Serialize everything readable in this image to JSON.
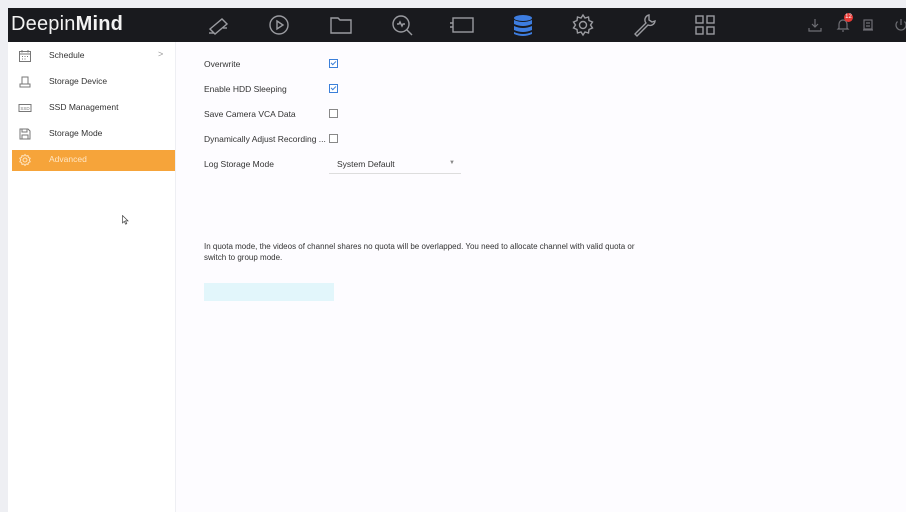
{
  "app": {
    "logo_light": "Deepin",
    "logo_bold": "Mind"
  },
  "topnav": [
    {
      "name": "camera-icon"
    },
    {
      "name": "playback-icon"
    },
    {
      "name": "folder-icon"
    },
    {
      "name": "search-icon"
    },
    {
      "name": "display-icon"
    },
    {
      "name": "storage-icon",
      "active": true
    },
    {
      "name": "gear-icon"
    },
    {
      "name": "wrench-icon"
    },
    {
      "name": "grid-icon"
    }
  ],
  "topright": {
    "download_icon": "download-icon",
    "bell_icon": "bell-icon",
    "notification_count": "12",
    "device_icon": "device-icon",
    "power_icon": "power-icon"
  },
  "sidebar": {
    "items": [
      {
        "label": "Schedule",
        "icon": "calendar-icon",
        "chevron": ">"
      },
      {
        "label": "Storage Device",
        "icon": "hdd-icon"
      },
      {
        "label": "SSD Management",
        "icon": "ssd-icon"
      },
      {
        "label": "Storage Mode",
        "icon": "save-icon"
      },
      {
        "label": "Advanced",
        "icon": "gear-icon",
        "active": true
      }
    ]
  },
  "settings": {
    "overwrite": {
      "label": "Overwrite",
      "checked": true
    },
    "hdd_sleeping": {
      "label": "Enable HDD Sleeping",
      "checked": true
    },
    "vca_data": {
      "label": "Save Camera VCA Data",
      "checked": false
    },
    "adjust_recording": {
      "label": "Dynamically Adjust Recording ...",
      "checked": false
    },
    "log_storage": {
      "label": "Log Storage Mode",
      "value": "System Default"
    }
  },
  "note": "In quota mode, the videos of channel shares no quota will be overlapped. You need to allocate channel with valid quota or switch to group mode.",
  "colors": {
    "accent": "#f6a43a",
    "active_nav": "#3d7de0",
    "topbar": "#191a1e",
    "apply_button": "#e2f6fb"
  }
}
